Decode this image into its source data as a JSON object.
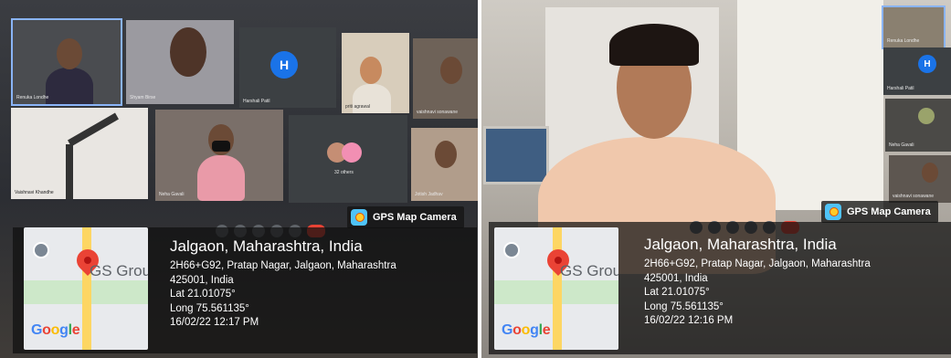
{
  "left_photo": {
    "participants": [
      {
        "name": "Renuka Londhe"
      },
      {
        "name": "Shyam Birse"
      },
      {
        "name": "Harshali Patil",
        "initial": "H"
      },
      {
        "name": "priti agrawal"
      },
      {
        "name": "vaishnavi sonawane"
      },
      {
        "name": "Vaishnavi Khandhe"
      },
      {
        "name": "Neha Gavali"
      },
      {
        "name": "32 others"
      },
      {
        "name": "Jotish Jadhav"
      }
    ],
    "gps": {
      "badge": "GPS Map Camera",
      "map_label": "GS Grou",
      "title": "Jalgaon, Maharashtra, India",
      "address_line1": "2H66+G92, Pratap Nagar, Jalgaon, Maharashtra",
      "address_line2": "425001, India",
      "lat": "Lat 21.01075°",
      "long": "Long 75.561135°",
      "datetime": "16/02/22 12:17 PM"
    }
  },
  "right_photo": {
    "side_participants": [
      {
        "name": "Renuka Londhe"
      },
      {
        "name": "Harshali Patil",
        "initial": "H"
      },
      {
        "name": "Neha Gavali"
      },
      {
        "name": "vaishnavi sonawane"
      }
    ],
    "gps": {
      "badge": "GPS Map Camera",
      "map_label": "GS Grou",
      "title": "Jalgaon, Maharashtra, India",
      "address_line1": "2H66+G92, Pratap Nagar, Jalgaon, Maharashtra",
      "address_line2": "425001, India",
      "lat": "Lat 21.01075°",
      "long": "Long 75.561135°",
      "datetime": "16/02/22 12:16 PM"
    }
  },
  "google_logo": [
    "G",
    "o",
    "o",
    "g",
    "l",
    "e"
  ],
  "colors": {
    "pin": "#ea4335",
    "avatar": "#1a73e8",
    "overlay": "#0f0f0f"
  }
}
